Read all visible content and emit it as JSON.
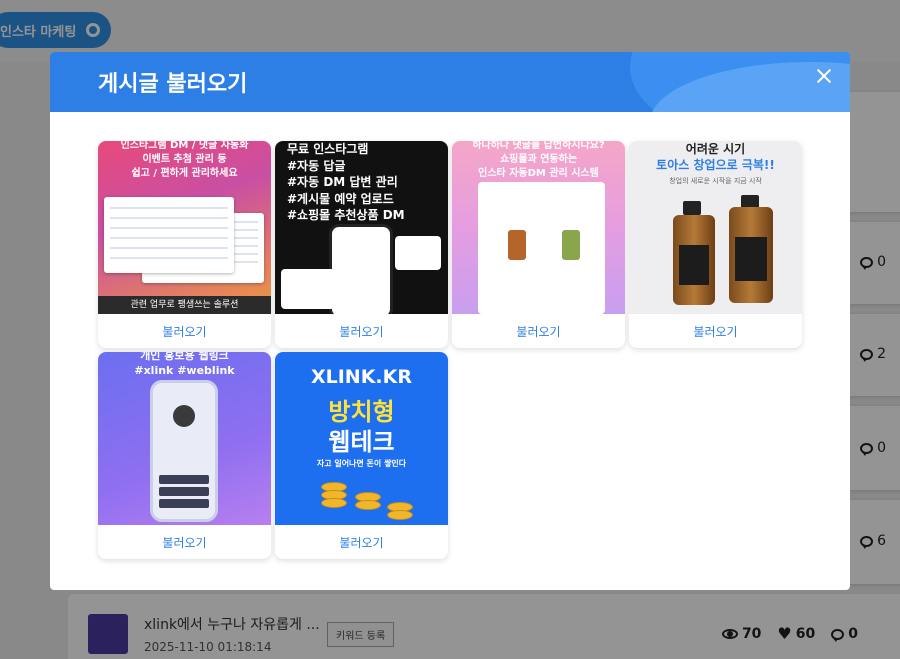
{
  "background": {
    "top_pill_label": "인스타 마케팅",
    "comment_counts": [
      "0",
      "2",
      "0",
      "6"
    ],
    "row": {
      "title": "xlink에서 누구나 자유롭게 ...",
      "date": "2025-11-10 01:18:14",
      "tag": "키워드 등록",
      "views": "70",
      "likes": "60",
      "comments": "0"
    }
  },
  "modal": {
    "title": "게시글 불러오기",
    "load_label": "불러오기",
    "cards": [
      {
        "caption_lines": [
          "인스타그램 DM / 댓글 자동화",
          "이벤트 추첨 관리 등",
          "쉽고 / 편하게 관리하세요"
        ],
        "footer": "관련 업무로 팽생쓰는 솔루션"
      },
      {
        "caption": "무료 인스타그램\n#자동 답글\n#자동 DM 답변 관리\n#게시물 예약 업로드\n#쇼핑몰 추천상품 DM"
      },
      {
        "caption_lines": [
          "하나하나 댓글을 답변하시나요?",
          "쇼핑몰과 연동하는",
          "인스타 자동DM 관리 시스템"
        ]
      },
      {
        "caption_lines": [
          "어려운 시기",
          "토아스 창업으로 극복!!",
          "창업의 새로운 시작을 지금 시작"
        ]
      },
      {
        "caption_lines": [
          "개인 홍보용 웹링크",
          "#xlink #weblink"
        ]
      },
      {
        "caption_lines": [
          "XLINK.KR",
          "방치형",
          "웹테크",
          "자고 일어나면 돈이 쌓인다"
        ]
      }
    ]
  },
  "colors": {
    "accent": "#2d7fe6",
    "header": "#2d7fe6"
  }
}
